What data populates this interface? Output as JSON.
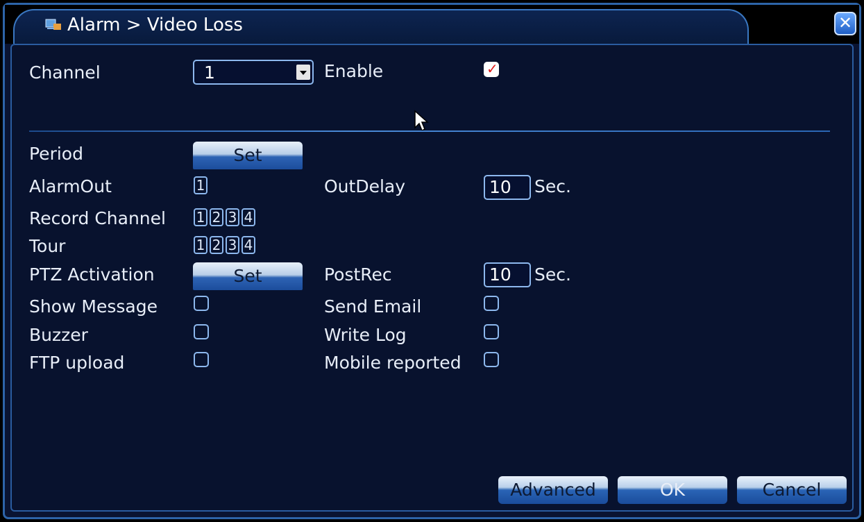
{
  "title": "Alarm > Video Loss",
  "form": {
    "channel_label": "Channel",
    "channel_value": "1",
    "enable_label": "Enable",
    "enable_checked": true,
    "period_label": "Period",
    "period_button": "Set",
    "alarmout_label": "AlarmOut",
    "alarmout_items": [
      "1"
    ],
    "outdelay_label": "OutDelay",
    "outdelay_value": "10",
    "outdelay_unit": "Sec.",
    "record_channel_label": "Record Channel",
    "record_channel_items": [
      "1",
      "2",
      "3",
      "4"
    ],
    "tour_label": "Tour",
    "tour_items": [
      "1",
      "2",
      "3",
      "4"
    ],
    "ptz_label": "PTZ Activation",
    "ptz_button": "Set",
    "postrec_label": "PostRec",
    "postrec_value": "10",
    "postrec_unit": "Sec.",
    "show_message_label": "Show Message",
    "send_email_label": "Send Email",
    "buzzer_label": "Buzzer",
    "write_log_label": "Write Log",
    "ftp_label": "FTP upload",
    "mobile_label": "Mobile reported"
  },
  "buttons": {
    "advanced": "Advanced",
    "ok": "OK",
    "cancel": "Cancel"
  },
  "icons": {
    "title": "alarm-icon",
    "close": "close-icon"
  },
  "colors": {
    "background": "#0a1432",
    "accent": "#2d64a8",
    "check_mark": "#e01818"
  }
}
